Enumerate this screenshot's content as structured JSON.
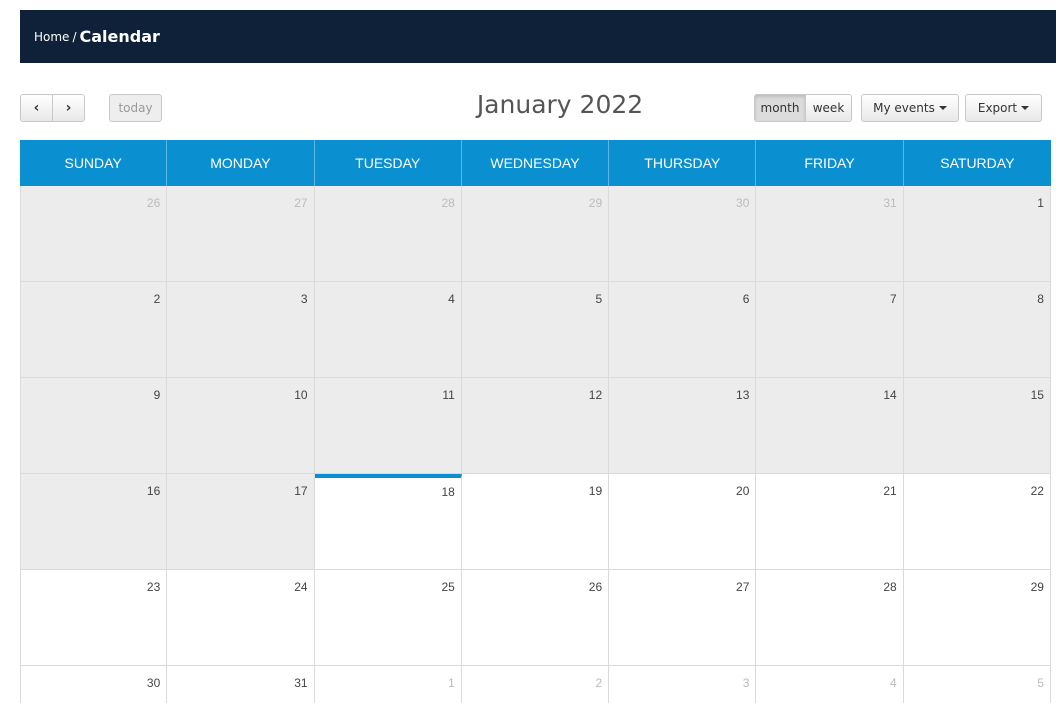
{
  "breadcrumb": {
    "home": "Home",
    "separator": "/",
    "current": "Calendar"
  },
  "toolbar": {
    "prev_icon": "‹",
    "next_icon": "›",
    "today_label": "today",
    "month_label": "month",
    "week_label": "week",
    "my_events_label": "My events",
    "export_label": "Export"
  },
  "calendar": {
    "title": "January 2022",
    "headers": [
      "SUNDAY",
      "MONDAY",
      "TUESDAY",
      "WEDNESDAY",
      "THURSDAY",
      "FRIDAY",
      "SATURDAY"
    ],
    "today": "18",
    "weeks": [
      [
        {
          "day": "26",
          "other": true,
          "past": true
        },
        {
          "day": "27",
          "other": true,
          "past": true
        },
        {
          "day": "28",
          "other": true,
          "past": true
        },
        {
          "day": "29",
          "other": true,
          "past": true
        },
        {
          "day": "30",
          "other": true,
          "past": true
        },
        {
          "day": "31",
          "other": true,
          "past": true
        },
        {
          "day": "1",
          "other": false,
          "past": true
        }
      ],
      [
        {
          "day": "2",
          "other": false,
          "past": true
        },
        {
          "day": "3",
          "other": false,
          "past": true
        },
        {
          "day": "4",
          "other": false,
          "past": true
        },
        {
          "day": "5",
          "other": false,
          "past": true
        },
        {
          "day": "6",
          "other": false,
          "past": true
        },
        {
          "day": "7",
          "other": false,
          "past": true
        },
        {
          "day": "8",
          "other": false,
          "past": true
        }
      ],
      [
        {
          "day": "9",
          "other": false,
          "past": true
        },
        {
          "day": "10",
          "other": false,
          "past": true
        },
        {
          "day": "11",
          "other": false,
          "past": true
        },
        {
          "day": "12",
          "other": false,
          "past": true
        },
        {
          "day": "13",
          "other": false,
          "past": true
        },
        {
          "day": "14",
          "other": false,
          "past": true
        },
        {
          "day": "15",
          "other": false,
          "past": true
        }
      ],
      [
        {
          "day": "16",
          "other": false,
          "past": true
        },
        {
          "day": "17",
          "other": false,
          "past": true
        },
        {
          "day": "18",
          "other": false,
          "past": false,
          "today": true
        },
        {
          "day": "19",
          "other": false,
          "past": false
        },
        {
          "day": "20",
          "other": false,
          "past": false
        },
        {
          "day": "21",
          "other": false,
          "past": false
        },
        {
          "day": "22",
          "other": false,
          "past": false
        }
      ],
      [
        {
          "day": "23",
          "other": false,
          "past": false
        },
        {
          "day": "24",
          "other": false,
          "past": false
        },
        {
          "day": "25",
          "other": false,
          "past": false
        },
        {
          "day": "26",
          "other": false,
          "past": false
        },
        {
          "day": "27",
          "other": false,
          "past": false
        },
        {
          "day": "28",
          "other": false,
          "past": false
        },
        {
          "day": "29",
          "other": false,
          "past": false
        }
      ],
      [
        {
          "day": "30",
          "other": false,
          "past": false
        },
        {
          "day": "31",
          "other": false,
          "past": false
        },
        {
          "day": "1",
          "other": true,
          "past": false
        },
        {
          "day": "2",
          "other": true,
          "past": false
        },
        {
          "day": "3",
          "other": true,
          "past": false
        },
        {
          "day": "4",
          "other": true,
          "past": false
        },
        {
          "day": "5",
          "other": true,
          "past": false
        }
      ]
    ]
  },
  "colors": {
    "topbar": "#0e2139",
    "header_accent": "#0a8fd1",
    "past_day_bg": "#ececec"
  }
}
